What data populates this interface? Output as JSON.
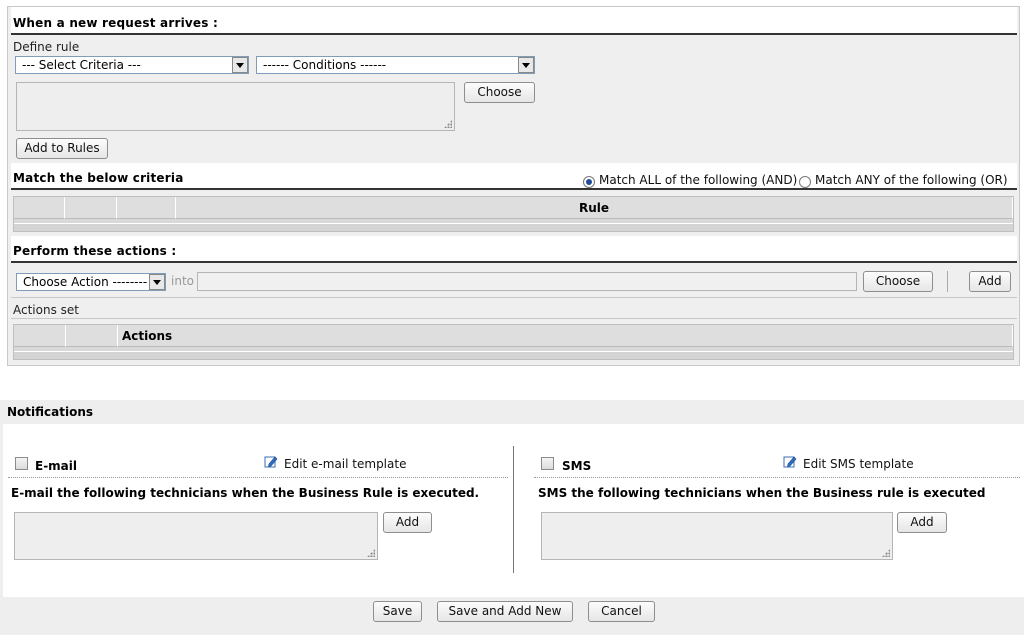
{
  "rule": {
    "header": "When a new request arrives :",
    "define_rule_label": "Define rule",
    "criteria_select": "--- Select Criteria ---",
    "conditions_select": "------ Conditions ------",
    "choose_label": "Choose",
    "add_to_rules_label": "Add to Rules"
  },
  "match": {
    "header": "Match the below criteria",
    "option_all": "Match ALL of the following (AND)",
    "option_any": "Match ANY of the following (OR)",
    "selected": "all",
    "rule_column": "Rule"
  },
  "actions": {
    "header": "Perform these actions :",
    "choose_action_select": "Choose Action --------",
    "into_label": "into",
    "choose_label": "Choose",
    "add_label": "Add",
    "actions_set_label": "Actions set",
    "actions_column": "Actions"
  },
  "notifications": {
    "header": "Notifications",
    "email": {
      "label": "E-mail",
      "edit_template": "Edit e-mail template",
      "description": "E-mail the following technicians when the Business Rule is executed.",
      "add_label": "Add",
      "checked": false
    },
    "sms": {
      "label": "SMS",
      "edit_template": "Edit SMS template",
      "description": "SMS the following technicians when the Business rule is executed",
      "add_label": "Add",
      "checked": false
    }
  },
  "footer": {
    "save_label": "Save",
    "save_add_new_label": "Save and Add New",
    "cancel_label": "Cancel"
  },
  "icons": {
    "edit_template": "edit-pencil-icon",
    "select_arrow": "chevron-down-icon",
    "resize_grip": "resize-grip-icon"
  },
  "colors": {
    "panel_bg": "#efefef",
    "header_rule": "#333333",
    "radio_dot": "#224c9a"
  }
}
